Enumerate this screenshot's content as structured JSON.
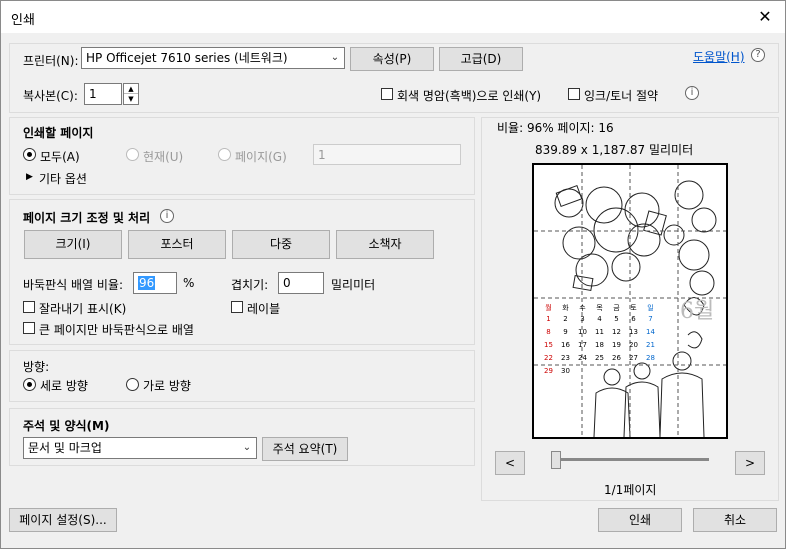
{
  "window": {
    "title": "인쇄"
  },
  "printer": {
    "label": "프린터(N):",
    "selected": "HP Officejet 7610 series (네트워크)",
    "properties_button": "속성(P)",
    "advanced_button": "고급(D)",
    "help_link": "도움말(H)"
  },
  "copies": {
    "label": "복사본(C):",
    "value": "1"
  },
  "options": {
    "grayscale_label": "회색 명암(흑백)으로 인쇄(Y)",
    "save_ink_label": "잉크/토너 절약"
  },
  "pages_to_print": {
    "heading": "인쇄할 페이지",
    "all_label": "모두(A)",
    "current_label": "현재(U)",
    "pages_label": "페이지(G)",
    "pages_value": "1",
    "more_options_label": "기타 옵션"
  },
  "page_sizing": {
    "heading": "페이지 크기 조정 및 처리",
    "tabs": [
      "크기(I)",
      "포스터",
      "다중",
      "소책자"
    ],
    "tile_scale_label": "바둑판식 배열 비율:",
    "tile_scale_value": "96",
    "percent_symbol": "%",
    "overlap_label": "겹치기:",
    "overlap_value": "0",
    "overlap_unit": "밀리미터",
    "cut_marks_label": "잘라내기 표시(K)",
    "labels_label": "레이블",
    "tile_large_label": "큰 페이지만 바둑판식으로 배열"
  },
  "orientation": {
    "heading": "방향:",
    "portrait_label": "세로 방향",
    "landscape_label": "가로 방향"
  },
  "comments": {
    "heading": "주석 및 양식(M)",
    "selected": "문서 및 마크업",
    "summarize_button": "주석 요약(T)"
  },
  "preview": {
    "scale_text": "비율: 96% 페이지: 16",
    "dimension_text": "839.89 x 1,187.87 밀리미터",
    "page_counter": "1/1페이지",
    "prev_label": "<",
    "next_label": ">",
    "slider_position": 0.0
  },
  "footer": {
    "page_setup_button": "페이지 설정(S)...",
    "print_button": "인쇄",
    "cancel_button": "취소"
  },
  "calendar": {
    "month": "6월",
    "header": [
      "월",
      "화",
      "수",
      "목",
      "금",
      "토",
      "일"
    ],
    "rows": [
      [
        "",
        "",
        "",
        "",
        "",
        "",
        ""
      ],
      [
        "1",
        "2",
        "3",
        "4",
        "5",
        "6",
        "7"
      ],
      [
        "8",
        "9",
        "10",
        "11",
        "12",
        "13",
        "14"
      ],
      [
        "15",
        "16",
        "17",
        "18",
        "19",
        "20",
        "21"
      ],
      [
        "22",
        "23",
        "24",
        "25",
        "26",
        "27",
        "28"
      ],
      [
        "29",
        "30",
        "",
        "",
        "",
        "",
        ""
      ]
    ]
  }
}
